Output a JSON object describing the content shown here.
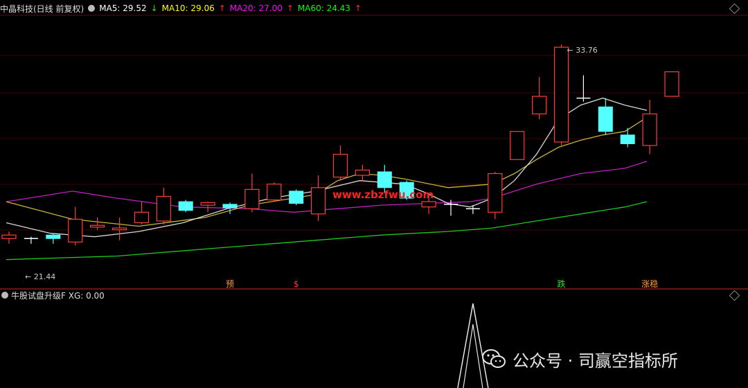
{
  "header": {
    "stock_label": "中晶科技(日线 前复权)",
    "ma5": {
      "label": "MA5: 29.52",
      "arrow": "↓",
      "color": "#ffffff"
    },
    "ma10": {
      "label": "MA10: 29.06",
      "arrow": "↑",
      "color": "#ffff00"
    },
    "ma20": {
      "label": "MA20: 27.00",
      "arrow": "↑",
      "color": "#ff00ff"
    },
    "ma60": {
      "label": "MA60: 24.43",
      "arrow": "↑",
      "color": "#00ff00"
    }
  },
  "sub_header": {
    "label": "牛股试盘升级F  XG: 0.00"
  },
  "watermark": {
    "text": "公众号 · 司赢空指标所",
    "overlay": "www.zbzfwu.com"
  },
  "chart_data": {
    "type": "candlestick",
    "price_range": [
      20.5,
      35.5
    ],
    "annotations": {
      "high_label": "33.76",
      "low_label": "21.44"
    },
    "candles": [
      {
        "o": 22.7,
        "c": 22.9,
        "h": 23.1,
        "l": 22.4
      },
      {
        "o": 22.7,
        "c": 22.7,
        "h": 22.8,
        "l": 22.4
      },
      {
        "o": 22.9,
        "c": 22.7,
        "h": 23.0,
        "l": 22.4
      },
      {
        "o": 22.5,
        "c": 23.8,
        "h": 24.5,
        "l": 22.3
      },
      {
        "o": 23.35,
        "c": 23.45,
        "h": 23.9,
        "l": 23.2
      },
      {
        "o": 23.2,
        "c": 23.3,
        "h": 23.9,
        "l": 22.6
      },
      {
        "o": 23.6,
        "c": 24.2,
        "h": 24.8,
        "l": 23.5
      },
      {
        "o": 23.7,
        "c": 25.1,
        "h": 25.6,
        "l": 23.5
      },
      {
        "o": 24.8,
        "c": 24.3,
        "h": 24.9,
        "l": 24.2
      },
      {
        "o": 24.6,
        "c": 24.75,
        "h": 24.8,
        "l": 24.2
      },
      {
        "o": 24.65,
        "c": 24.45,
        "h": 24.75,
        "l": 24.1
      },
      {
        "o": 24.4,
        "c": 25.5,
        "h": 26.4,
        "l": 24.2
      },
      {
        "o": 24.9,
        "c": 25.8,
        "h": 25.9,
        "l": 24.8
      },
      {
        "o": 25.4,
        "c": 24.7,
        "h": 25.5,
        "l": 24.6
      },
      {
        "o": 24.1,
        "c": 25.6,
        "h": 26.3,
        "l": 23.7
      },
      {
        "o": 26.2,
        "c": 27.5,
        "h": 28.0,
        "l": 26.0
      },
      {
        "o": 26.3,
        "c": 26.6,
        "h": 26.9,
        "l": 26.0
      },
      {
        "o": 26.5,
        "c": 25.6,
        "h": 26.9,
        "l": 25.3
      },
      {
        "o": 25.9,
        "c": 25.0,
        "h": 26.0,
        "l": 24.9
      },
      {
        "o": 24.5,
        "c": 24.8,
        "h": 25.3,
        "l": 24.1
      },
      {
        "o": 24.65,
        "c": 24.65,
        "h": 24.9,
        "l": 24.0
      },
      {
        "o": 24.4,
        "c": 24.4,
        "h": 24.6,
        "l": 24.1
      },
      {
        "o": 24.2,
        "c": 26.4,
        "h": 26.5,
        "l": 23.8
      },
      {
        "o": 27.2,
        "c": 28.8,
        "h": 28.8,
        "l": 27.2
      },
      {
        "o": 29.8,
        "c": 30.8,
        "h": 31.9,
        "l": 29.5
      },
      {
        "o": 28.2,
        "c": 33.6,
        "h": 33.76,
        "l": 28.0
      },
      {
        "o": 30.7,
        "c": 30.7,
        "h": 32.0,
        "l": 30.5
      },
      {
        "o": 30.2,
        "c": 28.8,
        "h": 30.7,
        "l": 28.6
      },
      {
        "o": 28.6,
        "c": 28.1,
        "h": 29.0,
        "l": 27.9
      },
      {
        "o": 28.0,
        "c": 29.8,
        "h": 30.6,
        "l": 27.5
      },
      {
        "o": 30.8,
        "c": 32.2,
        "h": 32.2,
        "l": 30.8
      }
    ],
    "ma5": [
      [
        0,
        23.6
      ],
      [
        2,
        23.0
      ],
      [
        4,
        22.8
      ],
      [
        6,
        23.1
      ],
      [
        8,
        23.6
      ],
      [
        10,
        24.4
      ],
      [
        12,
        25.0
      ],
      [
        14,
        25.4
      ],
      [
        16,
        26.0
      ],
      [
        18,
        25.8
      ],
      [
        19,
        25.3
      ],
      [
        20,
        24.7
      ],
      [
        21,
        24.5
      ],
      [
        22,
        25.0
      ],
      [
        23,
        26.0
      ],
      [
        24,
        27.5
      ],
      [
        25,
        29.5
      ],
      [
        26,
        30.3
      ],
      [
        27,
        30.7
      ],
      [
        28,
        30.3
      ],
      [
        29,
        30.0
      ]
    ],
    "ma10": [
      [
        0,
        24.8
      ],
      [
        3,
        23.8
      ],
      [
        6,
        23.4
      ],
      [
        9,
        23.9
      ],
      [
        11,
        24.6
      ],
      [
        13,
        25.0
      ],
      [
        14,
        25.2
      ],
      [
        15,
        26.0
      ],
      [
        16,
        26.4
      ],
      [
        17,
        26.3
      ],
      [
        18,
        26.1
      ],
      [
        20,
        25.6
      ],
      [
        22,
        25.8
      ],
      [
        23,
        26.4
      ],
      [
        24,
        27.2
      ],
      [
        25,
        27.9
      ],
      [
        26,
        28.3
      ],
      [
        27,
        28.6
      ],
      [
        28,
        28.8
      ],
      [
        29,
        29.6
      ]
    ],
    "ma20": [
      [
        0,
        24.8
      ],
      [
        3,
        25.4
      ],
      [
        5,
        25.0
      ],
      [
        8,
        24.5
      ],
      [
        11,
        24.4
      ],
      [
        13,
        24.2
      ],
      [
        15,
        24.4
      ],
      [
        17,
        24.6
      ],
      [
        19,
        24.7
      ],
      [
        21,
        24.8
      ],
      [
        22,
        25.0
      ],
      [
        24,
        25.8
      ],
      [
        26,
        26.4
      ],
      [
        28,
        26.7
      ],
      [
        29,
        27.1
      ]
    ],
    "ma60": [
      [
        0,
        21.5
      ],
      [
        5,
        21.7
      ],
      [
        10,
        22.2
      ],
      [
        14,
        22.6
      ],
      [
        17,
        22.9
      ],
      [
        20,
        23.1
      ],
      [
        22,
        23.3
      ],
      [
        24,
        23.7
      ],
      [
        26,
        24.1
      ],
      [
        28,
        24.5
      ],
      [
        29,
        24.8
      ]
    ],
    "bottom_labels": [
      {
        "index": 10,
        "text": "预",
        "color": "#ff9933"
      },
      {
        "index": 13,
        "text": "$",
        "color": "#ff3030"
      },
      {
        "index": 25,
        "text": "跌",
        "color": "#33dd33"
      },
      {
        "index": 29,
        "text": "涨稳",
        "color": "#ff9933"
      }
    ],
    "indicator": {
      "spike_index": 21,
      "values": [
        0,
        1,
        0
      ]
    }
  }
}
